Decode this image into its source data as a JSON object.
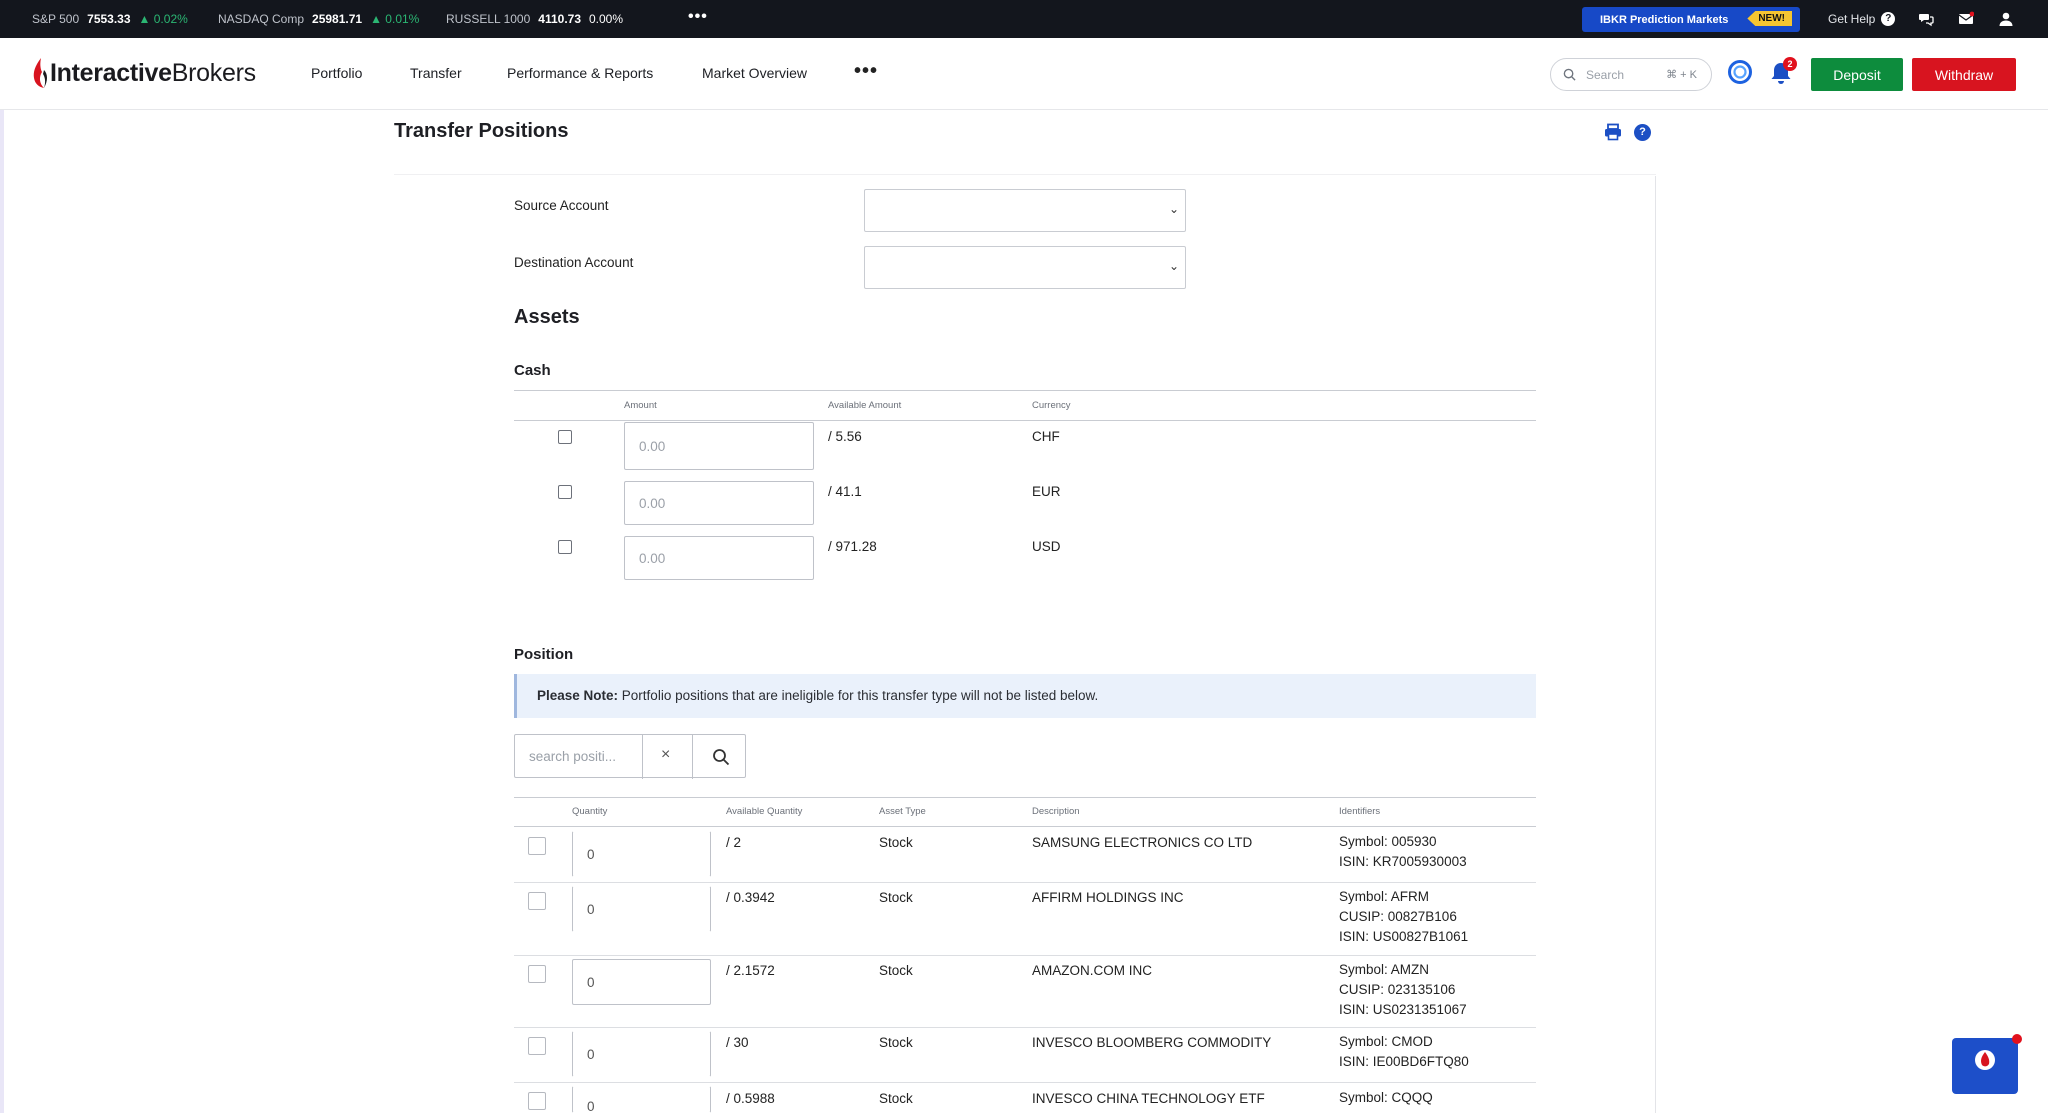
{
  "ticker": {
    "items": [
      {
        "name": "S&P 500",
        "value": "7553.33",
        "change": "▲ 0.02%",
        "trend": "up"
      },
      {
        "name": "NASDAQ Comp",
        "value": "25981.71",
        "change": "▲ 0.01%",
        "trend": "up"
      },
      {
        "name": "RUSSELL 1000",
        "value": "4110.73",
        "change": "0.00%",
        "trend": "flat"
      }
    ],
    "more": "•••",
    "promo": {
      "label": "IBKR Prediction Markets",
      "badge": "NEW!"
    },
    "get_help": "Get Help",
    "help_glyph": "?",
    "icons": [
      "chat-bubbles-icon",
      "mail-icon",
      "user-icon"
    ]
  },
  "header": {
    "logo": {
      "part1": "Interactive",
      "part2": "Brokers"
    },
    "nav": [
      "Portfolio",
      "Transfer",
      "Performance & Reports",
      "Market Overview"
    ],
    "nav_more": "•••",
    "search": {
      "placeholder": "Search",
      "shortcut": "⌘ + K"
    },
    "notification_count": "2",
    "deposit": "Deposit",
    "withdraw": "Withdraw",
    "colors": {
      "deposit": "#0d8c3d",
      "withdraw": "#d8141f",
      "accent": "#1c4fc4"
    }
  },
  "page": {
    "title": "Transfer Positions",
    "help_glyph": "?",
    "source_label": "Source Account",
    "destination_label": "Destination Account",
    "source_value": "",
    "destination_value": "",
    "chevron": "⌄",
    "assets_heading": "Assets",
    "cash_heading": "Cash",
    "position_heading": "Position"
  },
  "cash": {
    "headers": {
      "amount": "Amount",
      "available": "Available Amount",
      "currency": "Currency"
    },
    "rows": [
      {
        "amount_placeholder": "0.00",
        "available": "/ 5.56",
        "currency": "CHF"
      },
      {
        "amount_placeholder": "0.00",
        "available": "/ 41.1",
        "currency": "EUR"
      },
      {
        "amount_placeholder": "0.00",
        "available": "/ 971.28",
        "currency": "USD"
      }
    ]
  },
  "position": {
    "note_bold": "Please Note:",
    "note_text": " Portfolio positions that are ineligible for this transfer type will not be listed below.",
    "search_placeholder": "search positi...",
    "clear_glyph": "×",
    "headers": {
      "quantity": "Quantity",
      "available": "Available Quantity",
      "asset_type": "Asset Type",
      "description": "Description",
      "identifiers": "Identifiers"
    },
    "rows": [
      {
        "quantity": "0",
        "available": "/ 2",
        "asset_type": "Stock",
        "description": "SAMSUNG ELECTRONICS CO LTD",
        "id1": "Symbol: 005930",
        "id2": "ISIN: KR7005930003",
        "id3": ""
      },
      {
        "quantity": "0",
        "available": "/ 0.3942",
        "asset_type": "Stock",
        "description": "AFFIRM HOLDINGS INC",
        "id1": "Symbol: AFRM",
        "id2": "CUSIP: 00827B106",
        "id3": "ISIN: US00827B1061"
      },
      {
        "quantity": "0",
        "available": "/ 2.1572",
        "asset_type": "Stock",
        "description": "AMAZON.COM INC",
        "id1": "Symbol: AMZN",
        "id2": "CUSIP: 023135106",
        "id3": "ISIN: US0231351067"
      },
      {
        "quantity": "0",
        "available": "/ 30",
        "asset_type": "Stock",
        "description": "INVESCO BLOOMBERG COMMODITY",
        "id1": "Symbol: CMOD",
        "id2": "ISIN: IE00BD6FTQ80",
        "id3": ""
      },
      {
        "quantity": "0",
        "available": "/ 0.5988",
        "asset_type": "Stock",
        "description": "INVESCO CHINA TECHNOLOGY ETF",
        "id1": "Symbol: CQQQ",
        "id2": "",
        "id3": ""
      }
    ]
  }
}
